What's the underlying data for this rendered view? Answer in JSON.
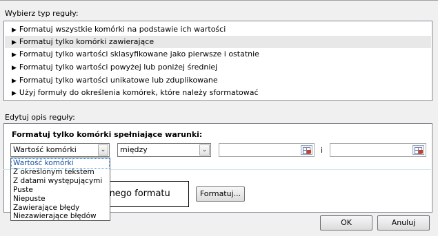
{
  "rule_type_label": "Wybierz typ reguły:",
  "rule_types": [
    "Formatuj wszystkie komórki na podstawie ich wartości",
    "Formatuj tylko komórki zawierające",
    "Formatuj tylko wartości sklasyfikowane jako pierwsze i ostatnie",
    "Formatuj tylko wartości powyżej lub poniżej średniej",
    "Formatuj tylko wartości unikatowe lub zduplikowane",
    "Użyj formuły do określenia komórek, które należy sformatować"
  ],
  "selected_rule_index": 1,
  "edit_label": "Edytuj opis reguły:",
  "desc_title": "Formatuj tylko komórki spełniające warunki:",
  "cell_value_select": "Wartość komórki",
  "operator_select": "między",
  "and_label": "i",
  "preview_text": "ionego formatu",
  "format_button": "Formatuj...",
  "ok_button": "OK",
  "cancel_button": "Anuluj",
  "dropdown_options": [
    "Wartość komórki",
    "Z określonym tekstem",
    "Z datami występującymi",
    "Puste",
    "Niepuste",
    "Zawierające błędy",
    "Niezawierające błędów"
  ],
  "dropdown_selected_index": 0,
  "icons": {
    "bullet": "triangle-right",
    "dropdown": "chevron-down",
    "picker": "collapse-dialog"
  }
}
